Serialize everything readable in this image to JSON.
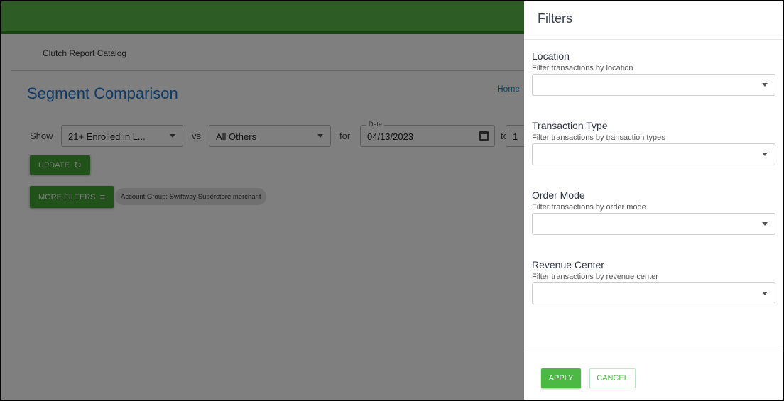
{
  "nav": {
    "catalog": "Clutch Report Catalog",
    "home": "Home"
  },
  "page": {
    "title": "Segment Comparison"
  },
  "controls": {
    "show_label": "Show",
    "segment1": "21+ Enrolled in L...",
    "vs_label": "vs",
    "segment2": "All Others",
    "for_label": "for",
    "date_label": "Date",
    "date_from": "04/13/2023",
    "to_label": "to",
    "date_to": "1",
    "update": "UPDATE",
    "more_filters": "MORE FILTERS",
    "chip": "Account Group: Swiftway Superstore merchant"
  },
  "filters": {
    "title": "Filters",
    "sections": [
      {
        "title": "Location",
        "subtitle": "Filter transactions by location",
        "value": ""
      },
      {
        "title": "Transaction Type",
        "subtitle": "Filter transactions by transaction types",
        "value": ""
      },
      {
        "title": "Order Mode",
        "subtitle": "Filter transactions by order mode",
        "value": ""
      },
      {
        "title": "Revenue Center",
        "subtitle": "Filter transactions by revenue center",
        "value": ""
      }
    ],
    "apply": "APPLY",
    "cancel": "CANCEL"
  },
  "colors": {
    "header": "#5bb84b",
    "accent": "#4cb944",
    "title": "#1976d2"
  }
}
